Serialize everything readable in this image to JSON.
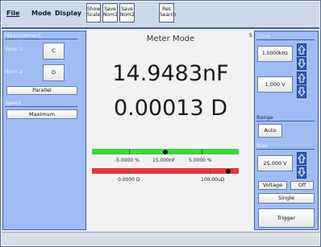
{
  "menu": {
    "file": "File",
    "mode": "Mode",
    "display": "Display"
  },
  "toolbar": {
    "show_scale": [
      "Show",
      "Scale"
    ],
    "save_nom1": [
      "Save",
      "Nom1"
    ],
    "save_nom2": [
      "Save",
      "Nom2"
    ],
    "res_search": [
      "Res",
      "Search"
    ]
  },
  "left": {
    "measurement_label": "Measurement",
    "term1_label": "Term 1",
    "term1_value": "C",
    "term2_label": "Term 2",
    "term2_value": "D",
    "parallel": "Parallel",
    "speed_label": "Speed",
    "speed_value": "Maximum"
  },
  "center": {
    "title": "Meter Mode",
    "corner_mark": "5",
    "primary": "14.9483nF",
    "secondary": "0.00013 D",
    "bar1": {
      "color": "#3dd63b",
      "labels": [
        "-5.0000 %",
        "15.000nF",
        "5.0000 %"
      ],
      "marker_fraction": 0.5
    },
    "bar2": {
      "color": "#e03a3a",
      "labels": [
        "0.0000 D",
        "100.00uD"
      ],
      "marker_fraction": 0.93
    }
  },
  "right": {
    "drive_label": "Drive",
    "frequency": "1.0000kHz",
    "level": "1.000 V",
    "range_label": "Range",
    "range_value": "Auto",
    "bias_label": "Bias",
    "bias_value": "25.000 V",
    "voltage": "Voltage",
    "off": "Off",
    "single": "Single",
    "trigger": "Trigger"
  },
  "icons": {
    "up": "arrow-up-icon",
    "down": "arrow-down-icon"
  }
}
